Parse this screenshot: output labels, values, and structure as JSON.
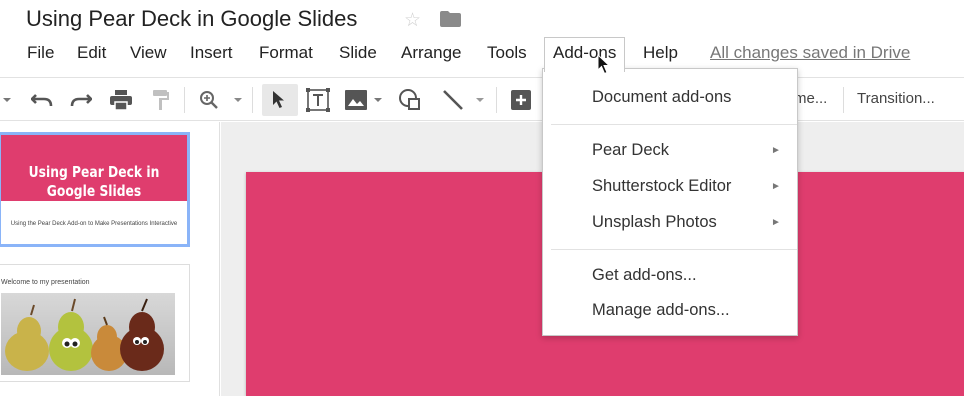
{
  "document": {
    "title": "Using Pear Deck in Google Slides"
  },
  "menubar": {
    "items": [
      "File",
      "Edit",
      "View",
      "Insert",
      "Format",
      "Slide",
      "Arrange",
      "Tools",
      "Add-ons",
      "Help"
    ],
    "status": "All changes saved in Drive"
  },
  "toolbar": {
    "theme_label": "me...",
    "transition_label": "Transition..."
  },
  "filmstrip": {
    "slides": [
      {
        "title": "Using Pear Deck in Google Slides",
        "subtitle": "Using the Pear Deck Add-on to Make Presentations Interactive"
      },
      {
        "title": "Welcome to my presentation"
      }
    ]
  },
  "addons_menu": {
    "items": [
      {
        "label": "Document add-ons"
      },
      {
        "label": "Pear Deck",
        "submenu": true
      },
      {
        "label": "Shutterstock Editor",
        "submenu": true
      },
      {
        "label": "Unsplash Photos",
        "submenu": true
      },
      {
        "label": "Get add-ons..."
      },
      {
        "label": "Manage add-ons..."
      }
    ]
  },
  "colors": {
    "slide_pink": "#df3d6e",
    "selection_blue": "#8ab4f8",
    "canvas_gray": "#eeeeee"
  },
  "icons": [
    "star-icon",
    "folder-icon",
    "undo-icon",
    "redo-icon",
    "print-icon",
    "paint-format-icon",
    "zoom-icon",
    "select-cursor-icon",
    "text-box-icon",
    "image-icon",
    "shape-icon",
    "line-icon",
    "new-comment-icon",
    "submenu-arrow-icon",
    "mouse-pointer-icon"
  ]
}
